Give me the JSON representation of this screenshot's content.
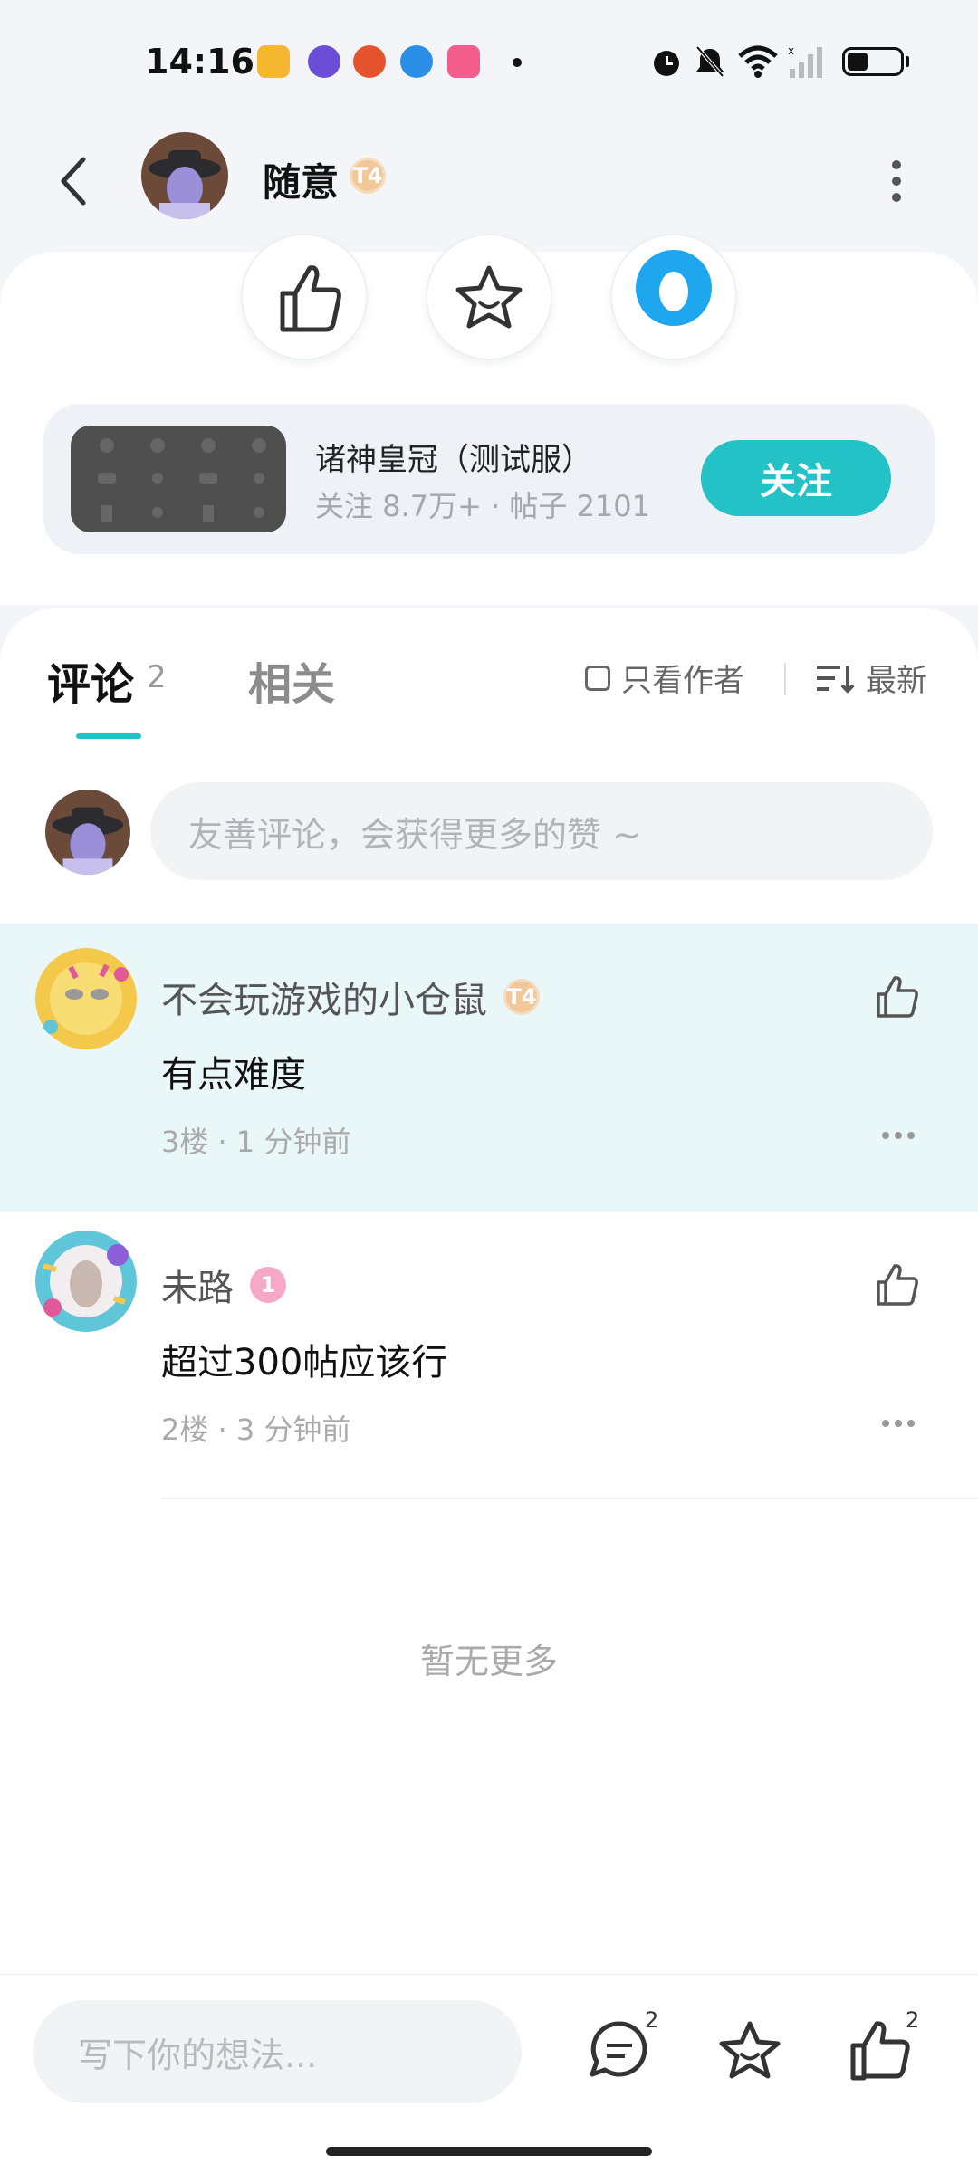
{
  "status_bar": {
    "time": "14:16",
    "apps": [
      {
        "name": "book-app-icon",
        "color": "#f5b731"
      },
      {
        "name": "purple-app-icon",
        "color": "#6b4ed8"
      },
      {
        "name": "red-app-icon",
        "color": "#e5532d"
      },
      {
        "name": "blue-app-icon",
        "color": "#2a8de6"
      },
      {
        "name": "bilibili-app-icon",
        "color": "#f25d8e"
      }
    ],
    "battery_level": 0.35
  },
  "header": {
    "username": "随意",
    "badge": "T4"
  },
  "actions": {
    "like_icon": "thumbs-up-icon",
    "favorite_icon": "star-icon",
    "share_icon": "qq-icon"
  },
  "forum": {
    "name": "诸神皇冠（测试服）",
    "stats": "关注 8.7万+ · 帖子 2101",
    "follow_label": "关注"
  },
  "tabs": {
    "comments_label": "评论",
    "comments_count": "2",
    "related_label": "相关",
    "only_author_label": "只看作者",
    "sort_label": "最新"
  },
  "comment_input": {
    "placeholder": "友善评论，会获得更多的赞 ~"
  },
  "comments": [
    {
      "author": "不会玩游戏的小仓鼠",
      "badge": "T4",
      "text": "有点难度",
      "meta": "3楼 · 1 分钟前",
      "highlight_color": "#e9f7f8"
    },
    {
      "author": "未路",
      "badge": "1",
      "text": "超过300帖应该行",
      "meta": "2楼 · 3 分钟前",
      "highlight_color": "#ffffff"
    }
  ],
  "footer": {
    "no_more": "暂无更多"
  },
  "bottom_bar": {
    "placeholder": "写下你的想法...",
    "comment_count": "2",
    "like_count": "2"
  },
  "colors": {
    "accent": "#23c2c6"
  }
}
